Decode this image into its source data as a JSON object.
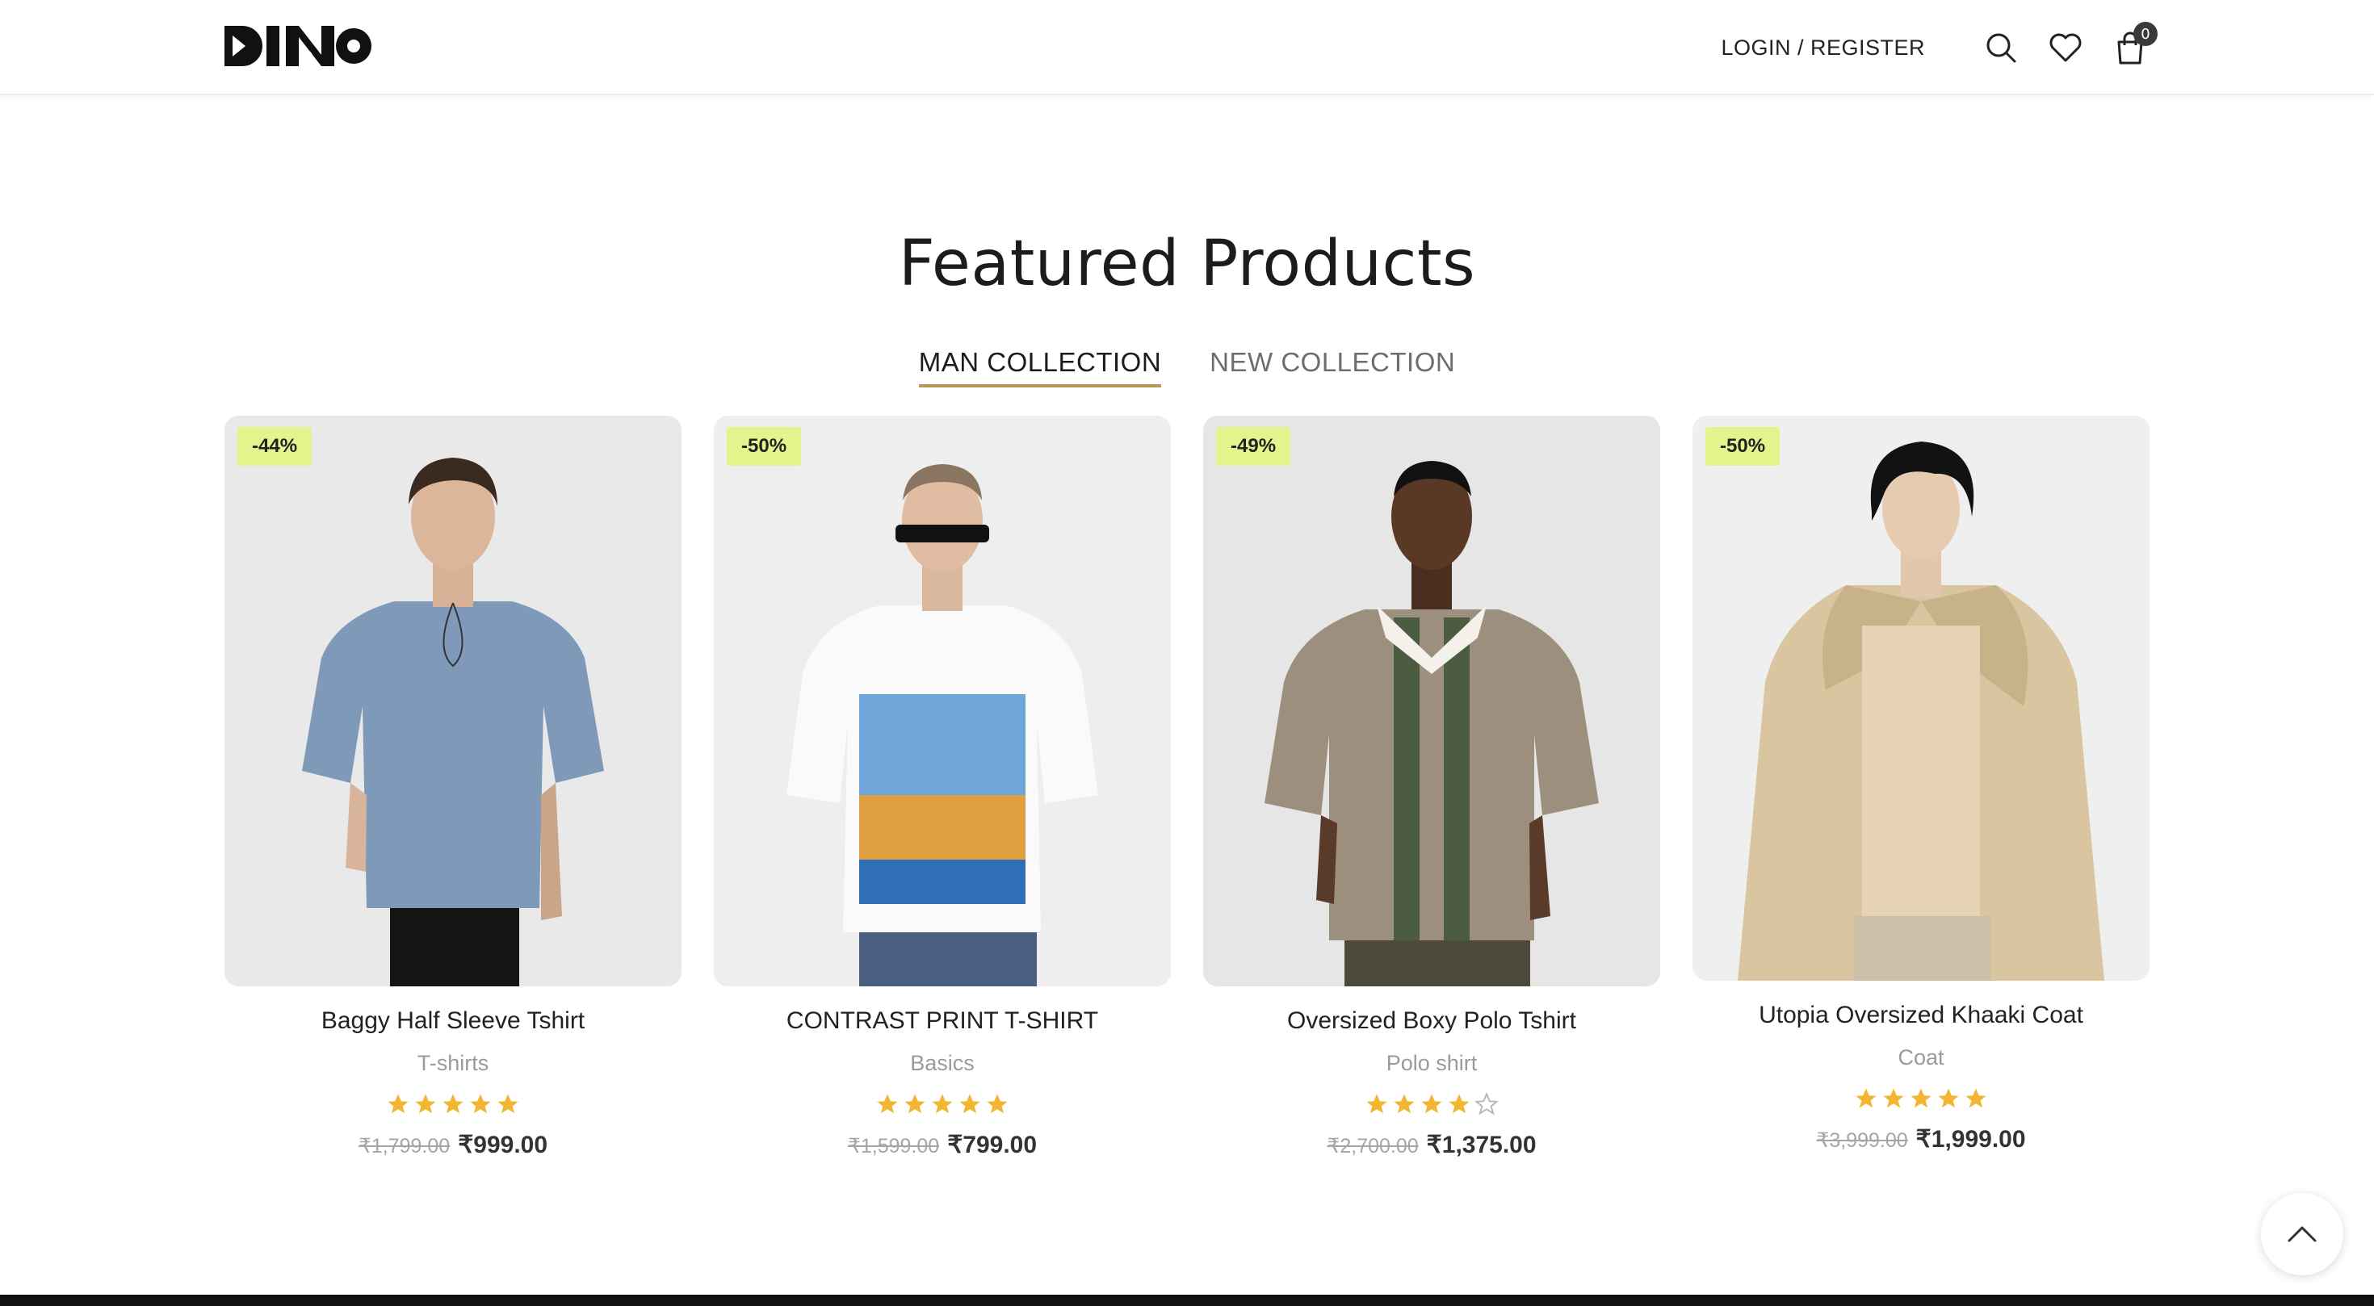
{
  "header": {
    "logo_text": "DINO",
    "login_label": "LOGIN / REGISTER",
    "cart_count": "0"
  },
  "section": {
    "title": "Featured Products"
  },
  "tabs": [
    {
      "label": "MAN COLLECTION",
      "active": true
    },
    {
      "label": "NEW COLLECTION",
      "active": false
    }
  ],
  "products": [
    {
      "discount": "-44%",
      "name": "Baggy Half Sleeve Tshirt",
      "category": "T-shirts",
      "rating": 5,
      "old_price": "₹1,799.00",
      "price": "₹999.00"
    },
    {
      "discount": "-50%",
      "name": "CONTRAST PRINT T-SHIRT",
      "category": "Basics",
      "rating": 5,
      "old_price": "₹1,599.00",
      "price": "₹799.00"
    },
    {
      "discount": "-49%",
      "name": "Oversized Boxy Polo Tshirt",
      "category": "Polo shirt",
      "rating": 4,
      "old_price": "₹2,700.00",
      "price": "₹1,375.00"
    },
    {
      "discount": "-50%",
      "name": "Utopia Oversized Khaaki Coat",
      "category": "Coat",
      "rating": 5,
      "old_price": "₹3,999.00",
      "price": "₹1,999.00"
    }
  ],
  "colors": {
    "tab_underline": "#b99656",
    "badge_bg": "#e4f48c",
    "star": "#f2b632"
  },
  "icons": [
    "search-icon",
    "heart-icon",
    "cart-icon",
    "chevron-up-icon",
    "star-icon"
  ]
}
